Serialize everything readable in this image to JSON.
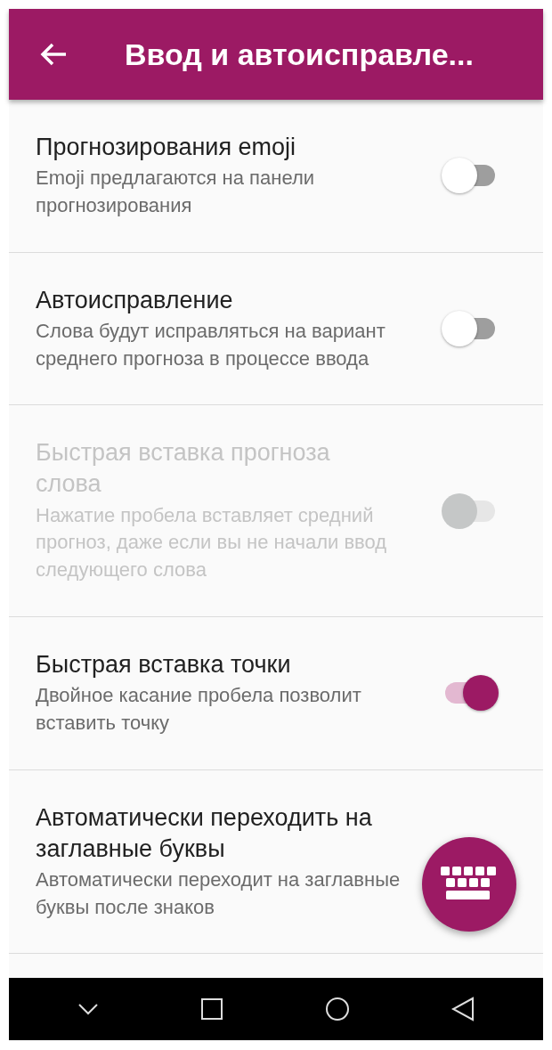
{
  "app_bar": {
    "title": "Ввод и автоисправле..."
  },
  "settings": [
    {
      "title": "Прогнозирования emoji",
      "description": "Emoji предлагаются на панели прогнозирования",
      "on": false,
      "disabled": false
    },
    {
      "title": "Автоисправление",
      "description": "Слова будут исправляться на вариант среднего прогноза в процессе ввода",
      "on": false,
      "disabled": false
    },
    {
      "title": "Быстрая вставка прогноза слова",
      "description": "Нажатие пробела вставляет средний прогноз, даже если вы не начали ввод следующего слова",
      "on": false,
      "disabled": true
    },
    {
      "title": "Быстрая вставка точки",
      "description": "Двойное касание пробела позволит вставить точку",
      "on": true,
      "disabled": false
    },
    {
      "title": "Автоматически переходить на заглавные буквы",
      "description": "Автоматически переходит на заглавные буквы после знаков",
      "disabled": false
    }
  ]
}
